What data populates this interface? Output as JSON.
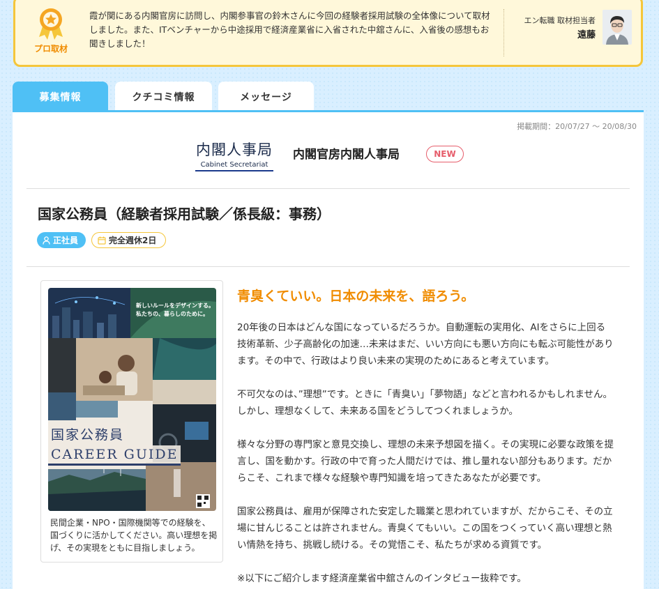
{
  "pro": {
    "badge_label": "プロ取材",
    "text": "霞が関にある内閣官房に訪問し、内閣参事官の鈴木さんに今回の経験者採用試験の全体像について取材しました。また、ITベンチャーから中途採用で経済産業省に入省された中舘さんに、入省後の感想もお聞きしました！",
    "author_role": "エン転職 取材担当者",
    "author_name": "遠藤"
  },
  "tabs": [
    {
      "label": "募集情報"
    },
    {
      "label": "クチコミ情報"
    },
    {
      "label": "メッセージ"
    }
  ],
  "listing": {
    "period": "掲載期間：20/07/27 ～ 20/08/30",
    "logo_ja": "内閣人事局",
    "logo_en": "Cabinet Secretariat",
    "company": "内閣官房内閣人事局",
    "new_label": "NEW",
    "job_title": "国家公務員（経験者採用試験／係長級：事務）",
    "tags": [
      "正社員",
      "完全週休2日"
    ]
  },
  "card": {
    "slogan_line1": "新しいルールをデザインする。",
    "slogan_line2": "私たちの、暮らしのために。",
    "cover_title": "国家公務員",
    "cover_sub": "CAREER GUIDE",
    "caption": "民間企業・NPO・国際機関等での経験を、国づくりに活かしてください。高い理想を掲げ、その実現をともに目指しましょう。"
  },
  "article": {
    "catch": "青臭くていい。日本の未来を、語ろう。",
    "paragraphs": [
      "20年後の日本はどんな国になっているだろうか。自動運転の実用化、AIをさらに上回る技術革新、少子高齢化の加速…未来はまだ、いい方向にも悪い方向にも転ぶ可能性があります。その中で、行政はより良い未来の実現のためにあると考えています。",
      "不可欠なのは、”理想”です。ときに「青臭い」「夢物語」などと言われるかもしれません。しかし、理想なくして、未来ある国をどうしてつくれましょうか。",
      "様々な分野の専門家と意見交換し、理想の未来予想図を描く。その実現に必要な政策を提言し、国を動かす。行政の中で育った人間だけでは、推し量れない部分もあります。だからこそ、これまで様々な経験や専門知識を培ってきたあなたが必要です。",
      "国家公務員は、雇用が保障された安定した職業と思われていますが、だからこそ、その立場に甘んじることは許されません。青臭くてもいい。この国をつくっていく高い理想と熱い情熱を持ち、挑戦し続ける。その覚悟こそ、私たちが求める資質です。",
      "※以下にご紹介します経済産業省中舘さんのインタビュー抜粋です。"
    ]
  },
  "colors": {
    "accent": "#4fc0f5",
    "gold": "#f5c63a",
    "orange": "#f08c00",
    "new_red": "#e65d6b"
  }
}
